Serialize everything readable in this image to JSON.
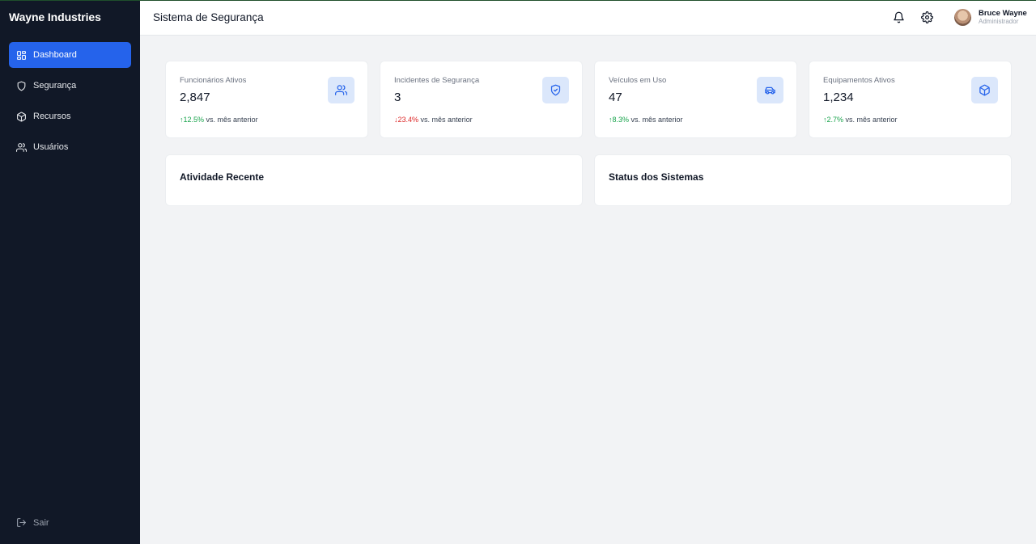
{
  "sidebar": {
    "brand": "Wayne Industries",
    "items": [
      {
        "label": "Dashboard",
        "icon": "dashboard-icon",
        "active": true
      },
      {
        "label": "Segurança",
        "icon": "shield-icon",
        "active": false
      },
      {
        "label": "Recursos",
        "icon": "box-icon",
        "active": false
      },
      {
        "label": "Usuários",
        "icon": "users-icon",
        "active": false
      }
    ],
    "logout_label": "Sair"
  },
  "header": {
    "title": "Sistema de Segurança",
    "user": {
      "name": "Bruce Wayne",
      "role": "Administrador"
    }
  },
  "stats": [
    {
      "label": "Funcionários Ativos",
      "value": "2,847",
      "trend": "12.5%",
      "trend_direction": "up",
      "trend_suffix": "vs. mês anterior",
      "icon": "users-icon"
    },
    {
      "label": "Incidentes de Segurança",
      "value": "3",
      "trend": "23.4%",
      "trend_direction": "down",
      "trend_suffix": "vs. mês anterior",
      "icon": "shield-check-icon"
    },
    {
      "label": "Veículos em Uso",
      "value": "47",
      "trend": "8.3%",
      "trend_direction": "up",
      "trend_suffix": "vs. mês anterior",
      "icon": "car-icon"
    },
    {
      "label": "Equipamentos Ativos",
      "value": "1,234",
      "trend": "2.7%",
      "trend_direction": "up",
      "trend_suffix": "vs. mês anterior",
      "icon": "box-icon"
    }
  ],
  "panels": {
    "recent_activity": "Atividade Recente",
    "systems_status": "Status dos Sistemas"
  },
  "colors": {
    "sidebar_bg": "#111827",
    "accent": "#2563eb",
    "trend_up": "#16a34a",
    "trend_down": "#dc2626"
  }
}
